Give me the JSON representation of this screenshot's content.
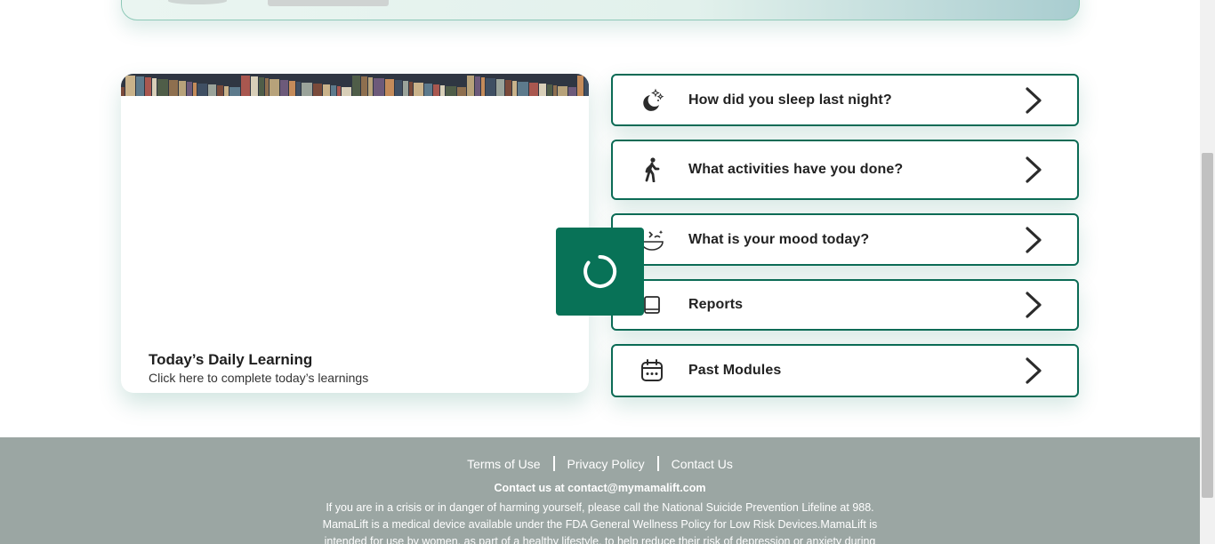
{
  "learning_card": {
    "title": "Today’s Daily Learning",
    "subtitle": "Click here to complete today’s learnings"
  },
  "actions": [
    {
      "label": "How did you sleep last night?",
      "icon": "moon-stars-icon"
    },
    {
      "label": "What activities have you done?",
      "icon": "walking-person-icon"
    },
    {
      "label": "What is your mood today?",
      "icon": "mood-bowl-icon"
    },
    {
      "label": "Reports",
      "icon": "report-book-icon"
    },
    {
      "label": "Past Modules",
      "icon": "calendar-icon"
    }
  ],
  "footer": {
    "links": [
      "Terms of Use",
      "Privacy Policy",
      "Contact Us"
    ],
    "contact": "Contact us at contact@mymamalift.com",
    "lines": [
      "If you are in a crisis or in danger of harming yourself, please call the National Suicide Prevention Lifeline at 988.",
      "MamaLift is a medical device available under the FDA General Wellness Policy for Low Risk Devices.MamaLift is",
      "intended for use by women, as part of a healthy lifestyle, to help reduce their risk of depression or anxiety during"
    ]
  },
  "colors": {
    "accent": "#0b6b55",
    "loader": "#087257",
    "footer_bg": "#9ba6a3"
  }
}
